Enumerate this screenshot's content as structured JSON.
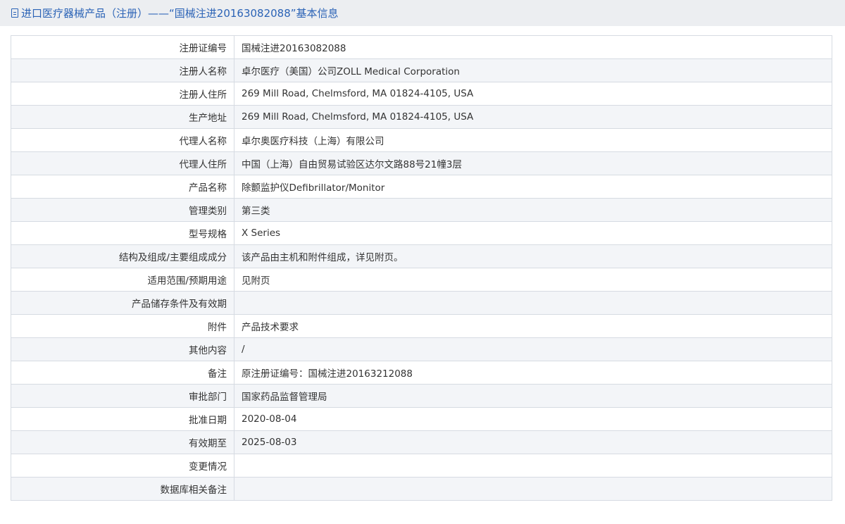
{
  "header": {
    "title": "进口医疗器械产品（注册）——“国械注进20163082088”基本信息"
  },
  "rows": [
    {
      "label": "注册证编号",
      "value": "国械注进20163082088"
    },
    {
      "label": "注册人名称",
      "value": "卓尔医疗（美国）公司ZOLL Medical Corporation"
    },
    {
      "label": "注册人住所",
      "value": "269 Mill Road, Chelmsford, MA 01824-4105, USA"
    },
    {
      "label": "生产地址",
      "value": "269 Mill Road, Chelmsford, MA 01824-4105, USA"
    },
    {
      "label": "代理人名称",
      "value": "卓尔奥医疗科技（上海）有限公司"
    },
    {
      "label": "代理人住所",
      "value": "中国（上海）自由贸易试验区达尔文路88号21幢3层"
    },
    {
      "label": "产品名称",
      "value": "除颤监护仪Defibrillator/Monitor"
    },
    {
      "label": "管理类别",
      "value": "第三类"
    },
    {
      "label": "型号规格",
      "value": "X Series"
    },
    {
      "label": "结构及组成/主要组成成分",
      "value": "该产品由主机和附件组成，详见附页。"
    },
    {
      "label": "适用范围/预期用途",
      "value": "见附页"
    },
    {
      "label": "产品储存条件及有效期",
      "value": ""
    },
    {
      "label": "附件",
      "value": "产品技术要求"
    },
    {
      "label": "其他内容",
      "value": "/"
    },
    {
      "label": "备注",
      "value": "原注册证编号：国械注进20163212088"
    },
    {
      "label": "审批部门",
      "value": "国家药品监督管理局"
    },
    {
      "label": "批准日期",
      "value": "2020-08-04"
    },
    {
      "label": "有效期至",
      "value": "2025-08-03"
    },
    {
      "label": "变更情况",
      "value": ""
    },
    {
      "label": "数据库相关备注",
      "value": ""
    }
  ]
}
